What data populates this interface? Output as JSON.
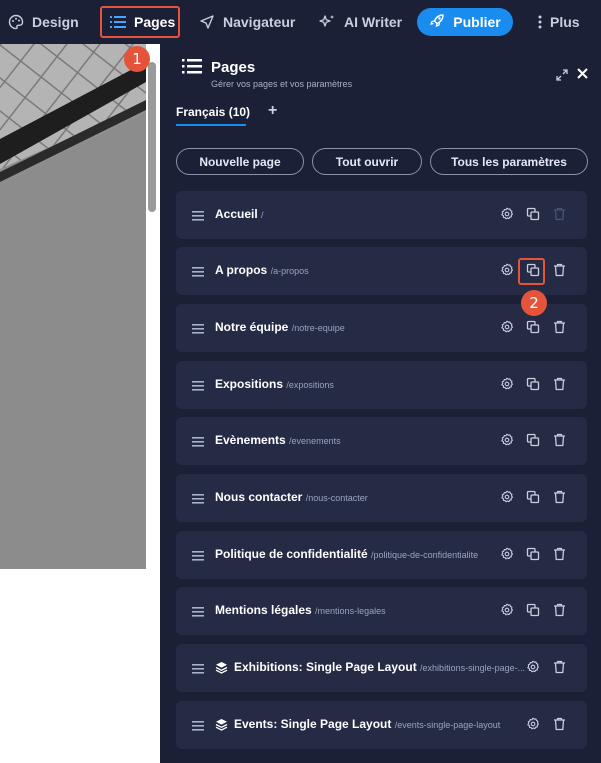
{
  "topbar": {
    "design_label": "Design",
    "pages_label": "Pages",
    "navigator_label": "Navigateur",
    "ai_label": "AI Writer",
    "publish_label": "Publier",
    "more_label": "Plus"
  },
  "badges": {
    "first": "1",
    "second": "2"
  },
  "panel": {
    "title": "Pages",
    "subtitle": "Gérer vos pages et vos paramètres",
    "language_tab": "Français (10)",
    "add_language": "+",
    "buttons": {
      "new_page": "Nouvelle page",
      "open_all": "Tout ouvrir",
      "all_settings": "Tous les paramètres"
    },
    "pages": [
      {
        "title": "Accueil",
        "slug": "/"
      },
      {
        "title": "A propos",
        "slug": "/a-propos"
      },
      {
        "title": "Notre équipe",
        "slug": "/notre-equipe"
      },
      {
        "title": "Expositions",
        "slug": "/expositions"
      },
      {
        "title": "Evènements",
        "slug": "/evenements"
      },
      {
        "title": "Nous contacter",
        "slug": "/nous-contacter"
      },
      {
        "title": "Politique de confidentialité",
        "slug": "/politique-de-confidentialite"
      },
      {
        "title": "Mentions légales",
        "slug": "/mentions-legales"
      },
      {
        "title": "Exhibitions: Single Page Layout",
        "slug": "/exhibitions-single-page-..."
      },
      {
        "title": "Events: Single Page Layout",
        "slug": "/events-single-page-layout"
      }
    ]
  },
  "colors": {
    "accent": "#1a8cf0",
    "highlight": "#e5533b",
    "panel_bg": "#1b2036",
    "row_bg": "#252b45"
  }
}
